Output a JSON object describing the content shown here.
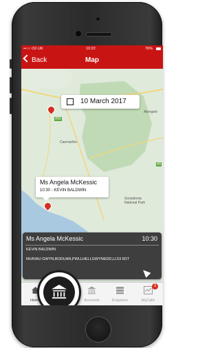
{
  "statusbar": {
    "carrier": "••○○ O2-UK",
    "time": "10:22",
    "battery": "76%"
  },
  "navbar": {
    "back_label": "Back",
    "title": "Map"
  },
  "map": {
    "date": "10 March 2017",
    "places": [
      "Abergele",
      "Caernarfon",
      "Snowdonia National Park"
    ],
    "road_labels": [
      "A55",
      "A5"
    ],
    "colors": {
      "land": "#dfeadb",
      "water": "#a9c9e0",
      "park": "#bcd8b0",
      "road": "#f2d67a"
    }
  },
  "tooltip": {
    "name": "Ms Angela McKessic",
    "detail": "10:30 - KEVIN BALDWIN"
  },
  "card": {
    "name": "Ms Angela McKessic",
    "time": "10:30",
    "staff": "KEVIN BALDWIN",
    "address": "MURIAU GWYN,BODUAN,PWLLHELI,GWYNEDD,LL53 6DT"
  },
  "tabs": [
    {
      "label": "Home",
      "icon": "home-icon"
    },
    {
      "label": "",
      "icon": "bank-icon"
    },
    {
      "label": "Accounts",
      "icon": "bank-icon"
    },
    {
      "label": "Enquiries",
      "icon": "server-icon"
    },
    {
      "label": "MyCalls",
      "icon": "calls-icon",
      "badge": "3"
    }
  ],
  "accent": "#c91414"
}
